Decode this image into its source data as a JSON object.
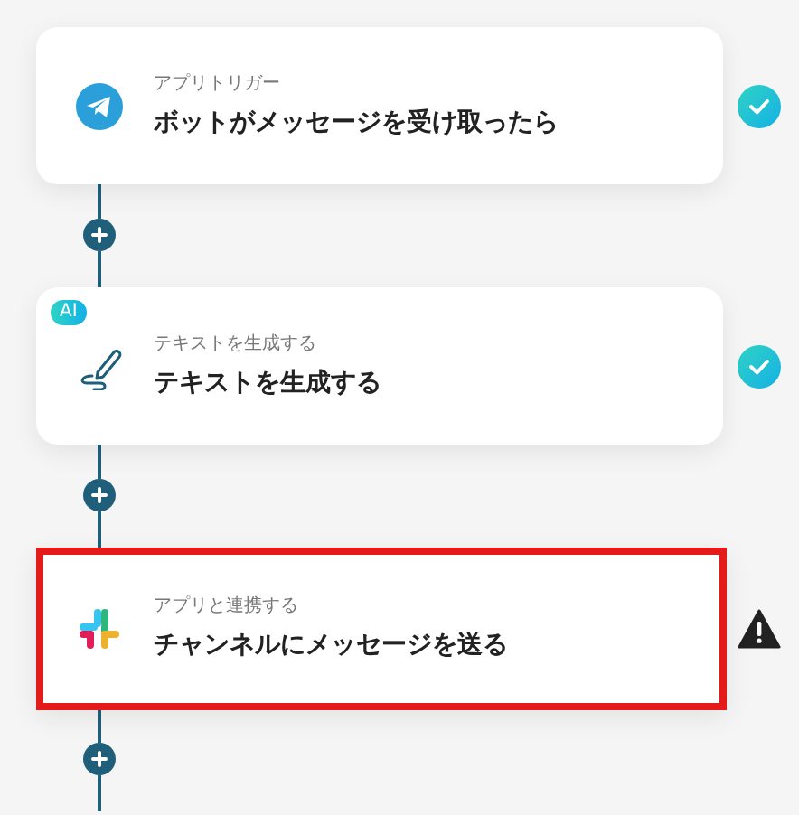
{
  "steps": [
    {
      "kind": "telegram",
      "label": "アプリトリガー",
      "title": "ボットがメッセージを受け取ったら",
      "done": true,
      "highlighted": false
    },
    {
      "kind": "ai",
      "badge": "AI",
      "label": "テキストを生成する",
      "title": "テキストを生成する",
      "done": true,
      "highlighted": false
    },
    {
      "kind": "slack",
      "label": "アプリと連携する",
      "title": "チャンネルにメッセージを送る",
      "done": false,
      "highlighted": true
    }
  ]
}
